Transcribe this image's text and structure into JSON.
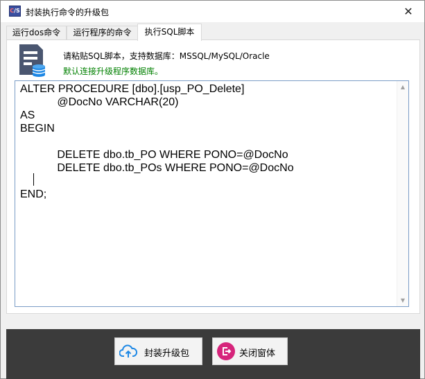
{
  "window": {
    "title": "封装执行命令的升级包",
    "close_glyph": "✕",
    "icon_text_c": "C",
    "icon_text_rest": "/S"
  },
  "tabs": [
    {
      "label": "运行dos命令",
      "active": false
    },
    {
      "label": "运行程序的命令",
      "active": false
    },
    {
      "label": "执行SQL脚本",
      "active": true
    }
  ],
  "panel": {
    "icon": "sql-document-database-icon",
    "info": "请粘贴SQL脚本，支持数据库：MSSQL/MySQL/Oracle",
    "hint": "默认连接升级程序数据库。",
    "hint_color": "#008000"
  },
  "editor": {
    "content": "ALTER PROCEDURE [dbo].[usp_PO_Delete]\n            @DocNo VARCHAR(20)\nAS\nBEGIN\n\n            DELETE dbo.tb_PO WHERE PONO=@DocNo\n            DELETE dbo.tb_POs WHERE PONO=@DocNo\n\nEND;"
  },
  "footer": {
    "package_button": {
      "label": "封装升级包",
      "icon": "cloud-upload-icon"
    },
    "close_button": {
      "label": "关闭窗体",
      "icon": "exit-icon"
    }
  },
  "colors": {
    "footer_bg": "#3b3b3b",
    "package_icon": "#1e88e5",
    "close_icon": "#d6247b"
  }
}
